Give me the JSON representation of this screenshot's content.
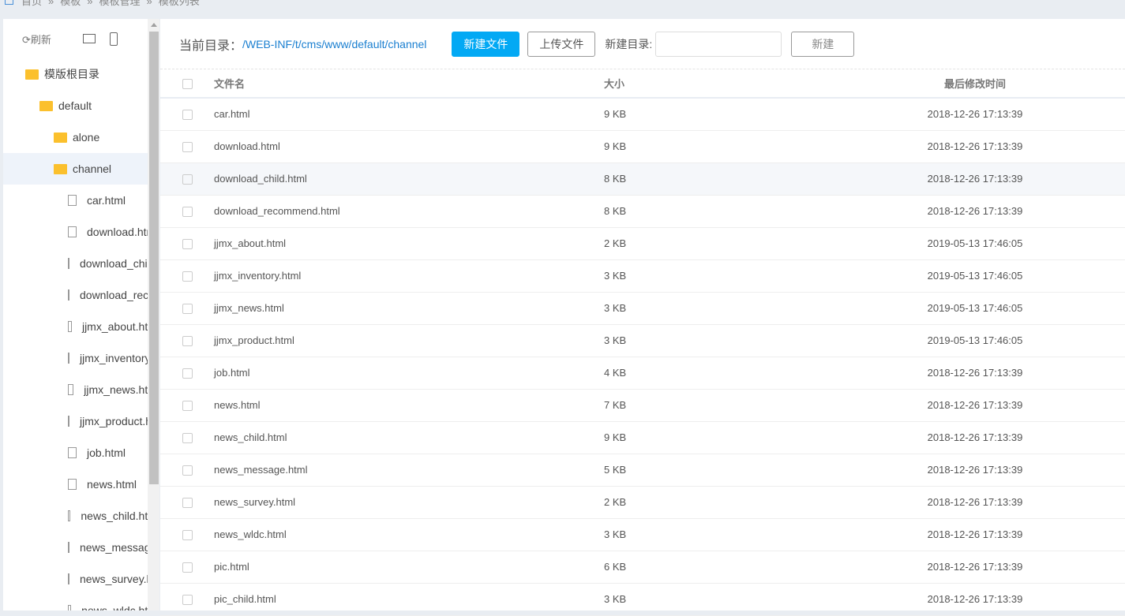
{
  "breadcrumb": [
    "首页",
    "»",
    "模板",
    "»",
    "模板管理",
    "»",
    "模板列表"
  ],
  "sidebar": {
    "refresh": "刷新",
    "root": "模版根目录",
    "tree": [
      {
        "label": "default",
        "type": "folder-open",
        "level": 1
      },
      {
        "label": "alone",
        "type": "folder",
        "level": 2
      },
      {
        "label": "channel",
        "type": "folder-open",
        "level": 2,
        "selected": true
      },
      {
        "label": "car.html",
        "type": "file",
        "level": 3
      },
      {
        "label": "download.html",
        "type": "file",
        "level": 3
      },
      {
        "label": "download_child.html",
        "type": "file",
        "level": 3
      },
      {
        "label": "download_recommend.html",
        "type": "file",
        "level": 3
      },
      {
        "label": "jjmx_about.html",
        "type": "file",
        "level": 3
      },
      {
        "label": "jjmx_inventory.html",
        "type": "file",
        "level": 3
      },
      {
        "label": "jjmx_news.html",
        "type": "file",
        "level": 3
      },
      {
        "label": "jjmx_product.html",
        "type": "file",
        "level": 3
      },
      {
        "label": "job.html",
        "type": "file",
        "level": 3
      },
      {
        "label": "news.html",
        "type": "file",
        "level": 3
      },
      {
        "label": "news_child.html",
        "type": "file",
        "level": 3
      },
      {
        "label": "news_message.html",
        "type": "file",
        "level": 3
      },
      {
        "label": "news_survey.html",
        "type": "file",
        "level": 3
      },
      {
        "label": "news_wldc.html",
        "type": "file",
        "level": 3
      }
    ]
  },
  "toolbar": {
    "current_dir_label": "当前目录：",
    "current_dir": "/WEB-INF/t/cms/www/default/channel",
    "new_file": "新建文件",
    "upload": "上传文件",
    "new_dir_label": "新建目录:",
    "new_dir_value": "",
    "create": "新建"
  },
  "table": {
    "headers": [
      "文件名",
      "大小",
      "最后修改时间"
    ],
    "rows": [
      [
        "car.html",
        "9 KB",
        "2018-12-26 17:13:39"
      ],
      [
        "download.html",
        "9 KB",
        "2018-12-26 17:13:39"
      ],
      [
        "download_child.html",
        "8 KB",
        "2018-12-26 17:13:39"
      ],
      [
        "download_recommend.html",
        "8 KB",
        "2018-12-26 17:13:39"
      ],
      [
        "jjmx_about.html",
        "2 KB",
        "2019-05-13 17:46:05"
      ],
      [
        "jjmx_inventory.html",
        "3 KB",
        "2019-05-13 17:46:05"
      ],
      [
        "jjmx_news.html",
        "3 KB",
        "2019-05-13 17:46:05"
      ],
      [
        "jjmx_product.html",
        "3 KB",
        "2019-05-13 17:46:05"
      ],
      [
        "job.html",
        "4 KB",
        "2018-12-26 17:13:39"
      ],
      [
        "news.html",
        "7 KB",
        "2018-12-26 17:13:39"
      ],
      [
        "news_child.html",
        "9 KB",
        "2018-12-26 17:13:39"
      ],
      [
        "news_message.html",
        "5 KB",
        "2018-12-26 17:13:39"
      ],
      [
        "news_survey.html",
        "2 KB",
        "2018-12-26 17:13:39"
      ],
      [
        "news_wldc.html",
        "3 KB",
        "2018-12-26 17:13:39"
      ],
      [
        "pic.html",
        "6 KB",
        "2018-12-26 17:13:39"
      ],
      [
        "pic_child.html",
        "3 KB",
        "2018-12-26 17:13:39"
      ]
    ]
  }
}
